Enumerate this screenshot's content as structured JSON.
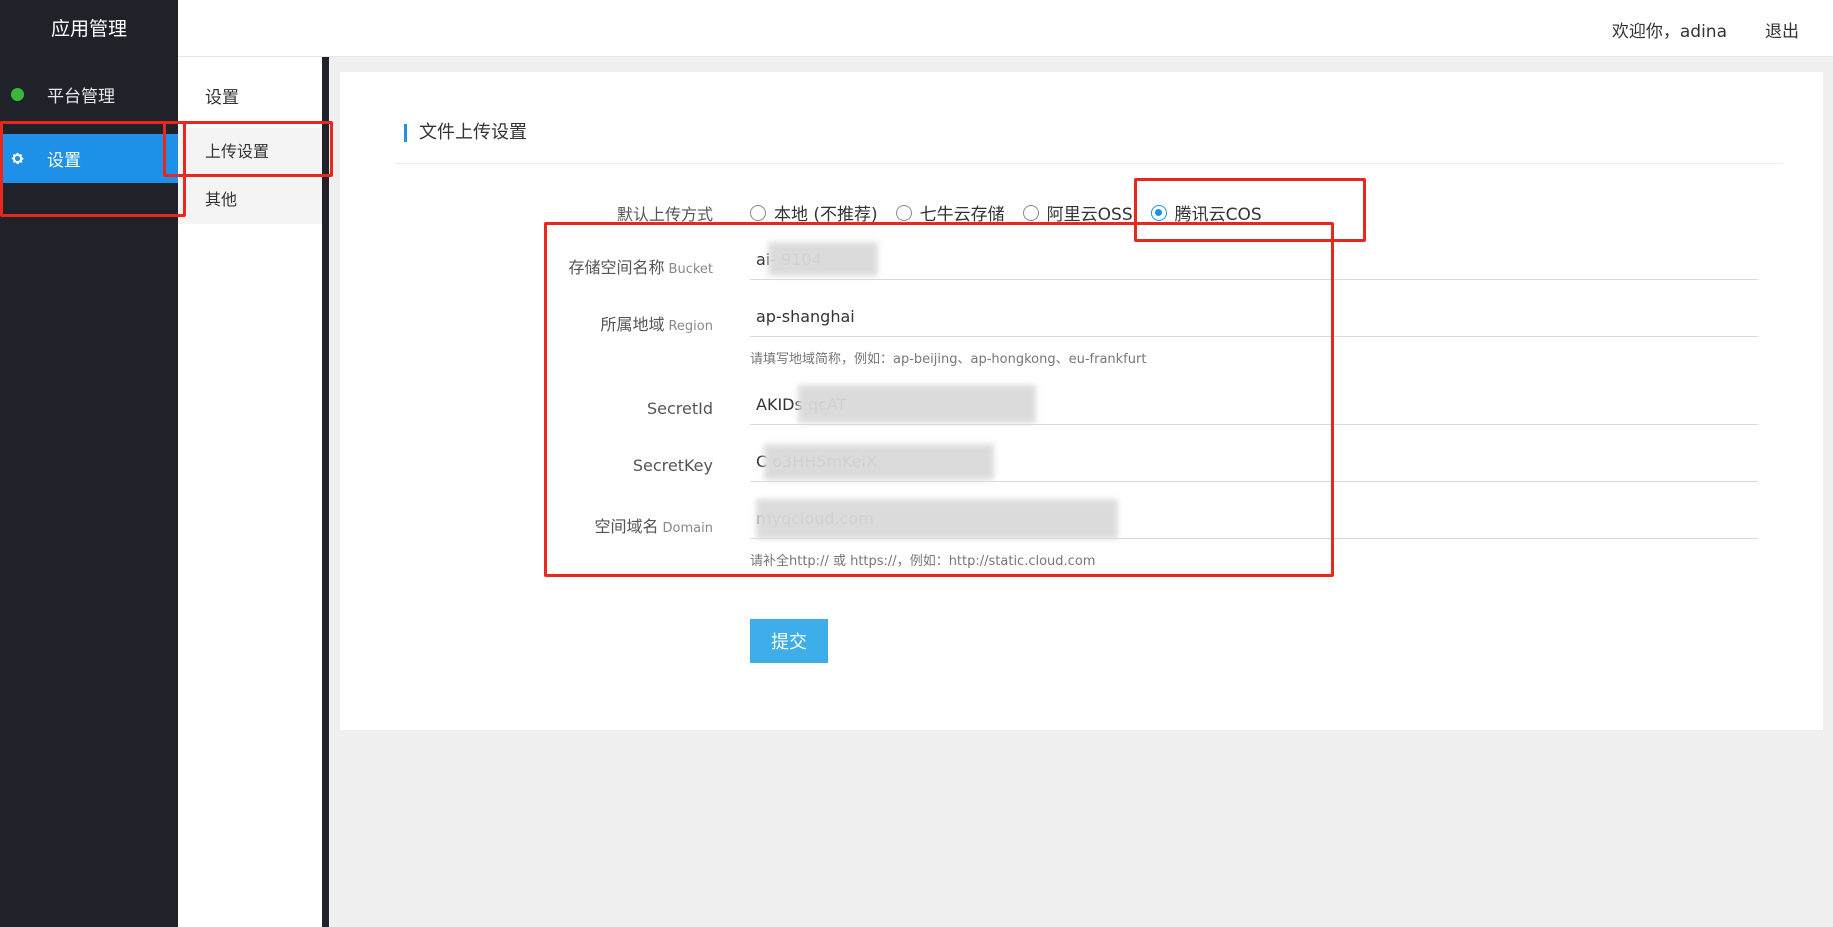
{
  "app": {
    "title": "应用管理"
  },
  "sidebar": {
    "items": [
      {
        "label": "平台管理",
        "icon": "platform-icon"
      },
      {
        "label": "设置",
        "icon": "gear-icon"
      }
    ]
  },
  "topbar": {
    "welcome": "欢迎你，adina",
    "logout": "退出"
  },
  "subnav": {
    "title": "设置",
    "items": [
      {
        "label": "上传设置"
      },
      {
        "label": "其他"
      }
    ]
  },
  "form": {
    "section_title": "文件上传设置",
    "upload_method": {
      "label": "默认上传方式",
      "options": [
        "本地 (不推荐)",
        "七牛云存储",
        "阿里云OSS",
        "腾讯云COS"
      ],
      "selected": "腾讯云COS"
    },
    "bucket": {
      "label": "存储空间名称",
      "label_en": "Bucket",
      "value": "ai-           9104"
    },
    "region": {
      "label": "所属地域",
      "label_en": "Region",
      "value": "ap-shanghai",
      "hint": "请填写地域简称，例如：ap-beijing、ap-hongkong、eu-frankfurt"
    },
    "secret_id": {
      "label": "SecretId",
      "value": "AKIDs                              qcAT"
    },
    "secret_key": {
      "label": "SecretKey",
      "value": "C                              o3HH5mKeiX"
    },
    "domain": {
      "label": "空间域名",
      "label_en": "Domain",
      "value": "                                                  myqcloud.com",
      "hint": "请补全http:// 或 https://，例如：http://static.cloud.com"
    },
    "submit_label": "提交"
  },
  "colors": {
    "accent": "#1e90e8",
    "sidebar_bg": "#20222a",
    "annotation_red": "#e8281f",
    "button": "#3daee9"
  }
}
